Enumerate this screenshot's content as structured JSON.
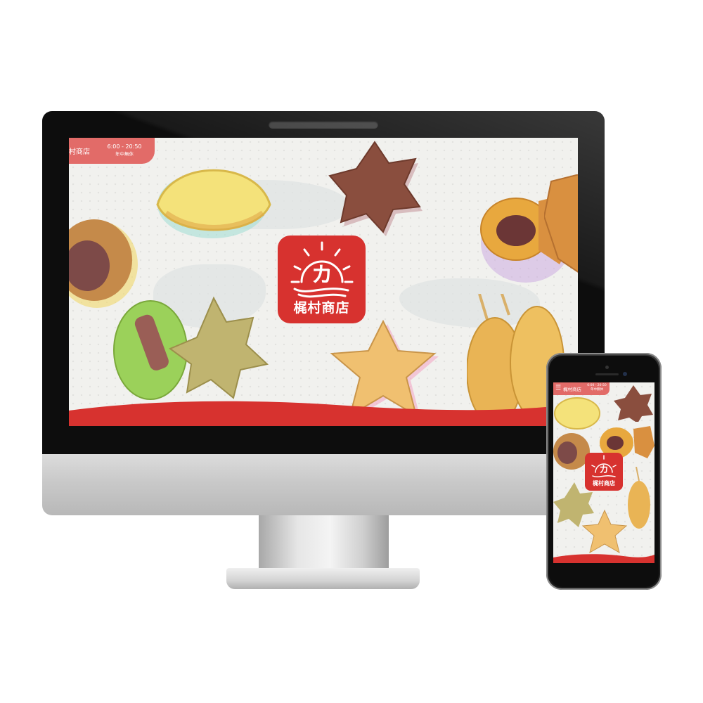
{
  "site": {
    "shop_name": "梶村商店",
    "shop_name_truncated": "村商店",
    "hours": "6:00 - 20:50",
    "closed_note": "年中無休",
    "logo_kanji": "カ",
    "logo_text": "梶村商店",
    "menu_icon": "hamburger-icon"
  },
  "colors": {
    "brand_red": "#d7322f",
    "header_pink": "#e26b68",
    "background": "#f1f1ee"
  }
}
